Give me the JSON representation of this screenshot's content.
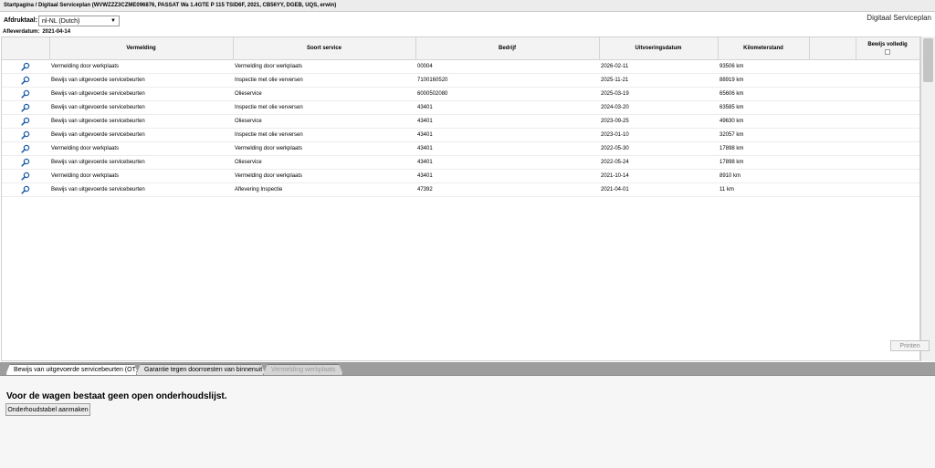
{
  "breadcrumb": "Startpagina / Digitaal Serviceplan (WVWZZZ3CZME096876, PASSAT Wa 1.4GTE P 115 TSID6F, 2021, CB56YY, DGEB, UQS, erwin)",
  "print_language": {
    "label": "Afdruktaal:",
    "selected": "nl-NL (Dutch)"
  },
  "app_title": "Digitaal Serviceplan",
  "delivery": {
    "label": "Afleverdatum:",
    "value": "2021-04-14"
  },
  "table": {
    "columns": [
      "Vermelding",
      "Soort service",
      "Bedrijf",
      "Uitvoeringsdatum",
      "Kilometerstand",
      "Bewijs volledig"
    ],
    "rows": [
      {
        "vermelding": "Vermelding door werkplaats",
        "soort": "Vermelding door werkplaats",
        "bedrijf": "00004",
        "datum": "2026-02-11",
        "km": "93506 km"
      },
      {
        "vermelding": "Bewijs van uitgevoerde servicebeurten",
        "soort": "Inspectie met olie verversen",
        "bedrijf": "7100160520",
        "datum": "2025-11-21",
        "km": "88919 km"
      },
      {
        "vermelding": "Bewijs van uitgevoerde servicebeurten",
        "soort": "Olieservice",
        "bedrijf": "6000502080",
        "datum": "2025-03-19",
        "km": "65606 km"
      },
      {
        "vermelding": "Bewijs van uitgevoerde servicebeurten",
        "soort": "Inspectie met olie verversen",
        "bedrijf": "43401",
        "datum": "2024-03-20",
        "km": "63585 km"
      },
      {
        "vermelding": "Bewijs van uitgevoerde servicebeurten",
        "soort": "Olieservice",
        "bedrijf": "43401",
        "datum": "2023-09-25",
        "km": "49630 km"
      },
      {
        "vermelding": "Bewijs van uitgevoerde servicebeurten",
        "soort": "Inspectie met olie verversen",
        "bedrijf": "43401",
        "datum": "2023-01-10",
        "km": "32057 km"
      },
      {
        "vermelding": "Vermelding door werkplaats",
        "soort": "Vermelding door werkplaats",
        "bedrijf": "43401",
        "datum": "2022-05-30",
        "km": "17898 km"
      },
      {
        "vermelding": "Bewijs van uitgevoerde servicebeurten",
        "soort": "Olieservice",
        "bedrijf": "43401",
        "datum": "2022-05-24",
        "km": "17898 km"
      },
      {
        "vermelding": "Vermelding door werkplaats",
        "soort": "Vermelding door werkplaats",
        "bedrijf": "43401",
        "datum": "2021-10-14",
        "km": "8910 km"
      },
      {
        "vermelding": "Bewijs van uitgevoerde servicebeurten",
        "soort": "Aflevering Inspectie",
        "bedrijf": "47392",
        "datum": "2021-04-01",
        "km": "11 km"
      }
    ]
  },
  "print_button": "Printen",
  "tabs": [
    {
      "label": "Bewijs van uitgevoerde servicebeurten (OT)",
      "state": "active"
    },
    {
      "label": "Garantie tegen doorroesten van binnenuit",
      "state": "normal"
    },
    {
      "label": "Vermelding werkplaats",
      "state": "disabled"
    }
  ],
  "panel": {
    "message": "Voor de wagen bestaat geen open onderhoudslijst.",
    "create_button": "Onderhoudstabel aanmaken"
  },
  "icons": {
    "row_action": "magnifier-icon",
    "dropdown": "chevron-down-icon"
  },
  "colors": {
    "icon_blue": "#1f5fa8",
    "tab_strip": "#9d9d9d"
  }
}
